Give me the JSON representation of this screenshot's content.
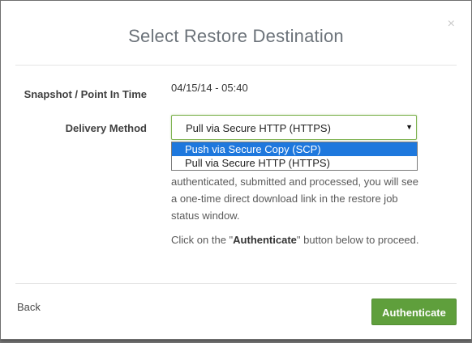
{
  "modal": {
    "title": "Select Restore Destination",
    "close_icon": "×"
  },
  "form": {
    "snapshot_label": "Snapshot / Point In Time",
    "snapshot_value": "04/15/14 - 05:40",
    "delivery_label": "Delivery Method",
    "delivery_selected": "Pull via Secure HTTP (HTTPS)",
    "delivery_options": [
      "Push via Secure Copy (SCP)",
      "Pull via Secure HTTP (HTTPS)"
    ],
    "description": "authenticated, submitted and processed, you will see a one-time direct download link in the restore job status window.",
    "note_prefix": "Click on the \"",
    "note_bold": "Authenticate",
    "note_suffix": "\" button below to proceed."
  },
  "footer": {
    "back_label": "Back",
    "authenticate_label": "Authenticate"
  },
  "colors": {
    "accent": "#5f9f3c",
    "selection": "#1e78dd"
  }
}
